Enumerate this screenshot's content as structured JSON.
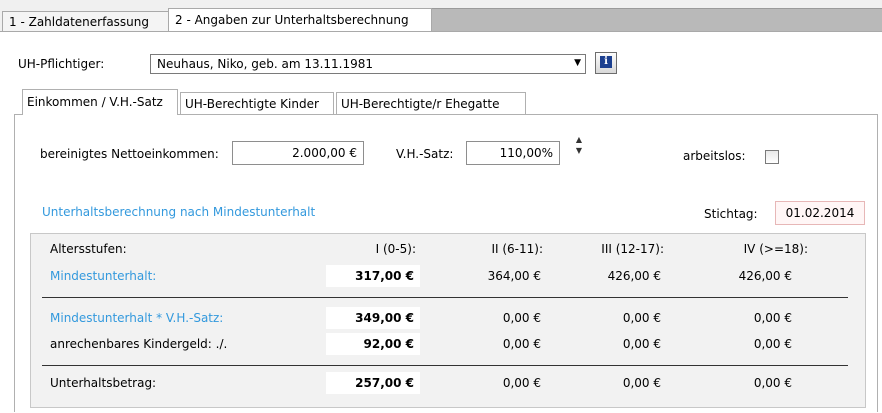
{
  "outer_tabs": [
    "1 - Zahldatenerfassung",
    "2 - Angaben zur Unterhaltsberechnung"
  ],
  "uh_pflichtiger": {
    "label": "UH-Pflichtiger:",
    "selected": "Neuhaus, Niko, geb. am 13.11.1981",
    "info_icon": "i"
  },
  "inner_tabs": [
    "Einkommen / V.H.-Satz",
    "UH-Berechtigte Kinder",
    "UH-Berechtigte/r Ehegatte"
  ],
  "income": {
    "net_label": "bereinigtes Nettoeinkommen:",
    "net_value": "2.000,00 €",
    "vh_label": "V.H.-Satz:",
    "vh_value": "110,00%",
    "arbeitslos_label": "arbeitslos:"
  },
  "section_title": "Unterhaltsberechnung nach Mindestunterhalt",
  "stichtag": {
    "label": "Stichtag:",
    "value": "01.02.2014"
  },
  "table": {
    "age_label": "Altersstufen:",
    "columns": [
      "I (0-5):",
      "II (6-11):",
      "III (12-17):",
      "IV (>=18):"
    ],
    "rows": {
      "mindest": {
        "label": "Mindestunterhalt:",
        "values": [
          "317,00 €",
          "364,00 €",
          "426,00 €",
          "426,00 €"
        ]
      },
      "mindest_vh": {
        "label": "Mindestunterhalt * V.H.-Satz:",
        "values": [
          "349,00 €",
          "0,00 €",
          "0,00 €",
          "0,00 €"
        ]
      },
      "kindergeld": {
        "label": "anrechenbares Kindergeld:  ./.",
        "values": [
          "92,00 €",
          "0,00 €",
          "0,00 €",
          "0,00 €"
        ]
      },
      "betrag": {
        "label": "Unterhaltsbetrag:",
        "values": [
          "257,00 €",
          "0,00 €",
          "0,00 €",
          "0,00 €"
        ]
      }
    }
  },
  "colors": {
    "accent_blue": "#3399dd",
    "date_bg": "#fff6f6"
  }
}
